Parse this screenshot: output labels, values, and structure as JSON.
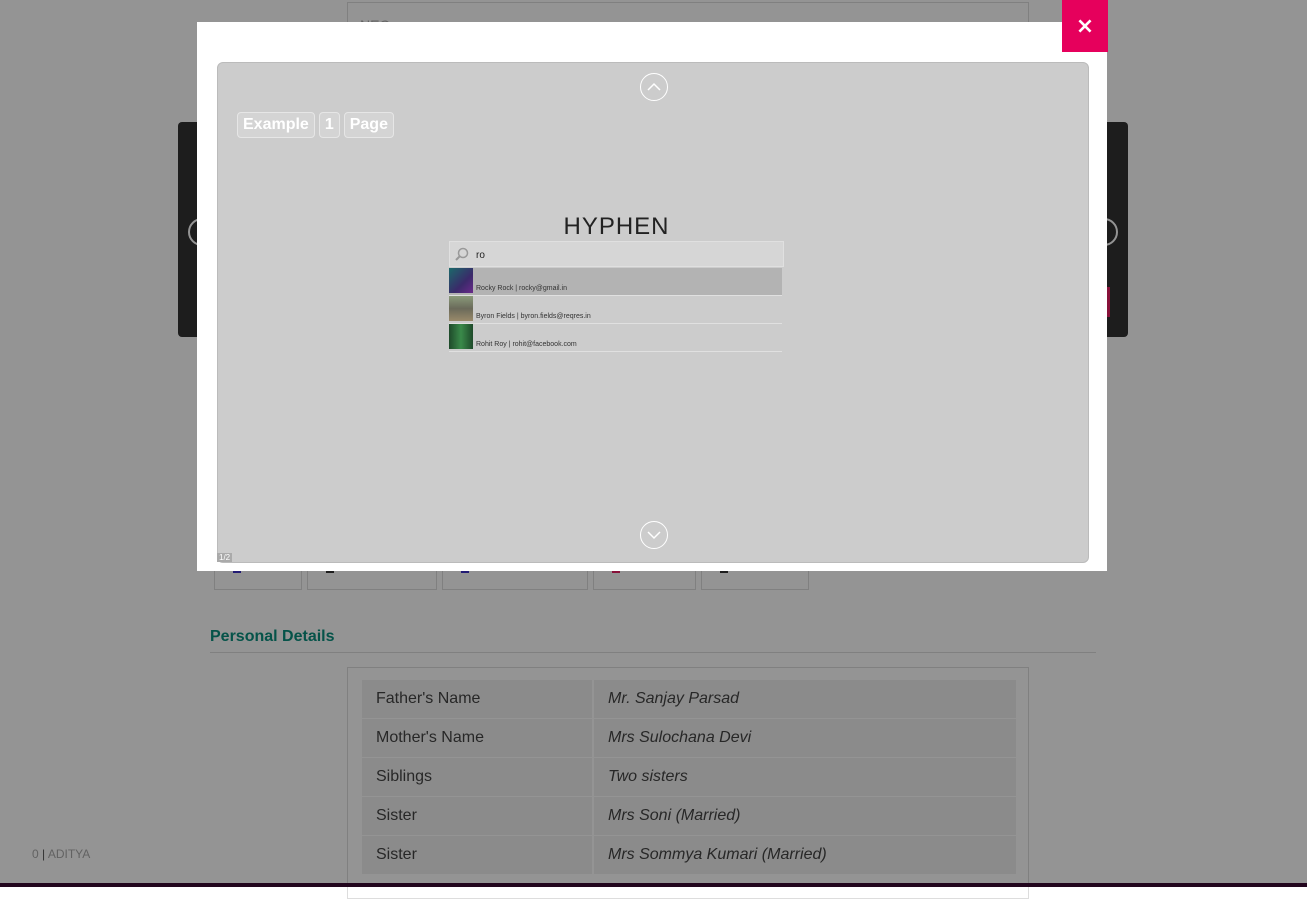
{
  "background": {
    "top_box_text": "NEO..........",
    "section_title": "Personal Details",
    "details": [
      {
        "key": "Father's Name",
        "value": "Mr. Sanjay Parsad"
      },
      {
        "key": "Mother's Name",
        "value": "Mrs Sulochana Devi"
      },
      {
        "key": "Siblings",
        "value": "Two sisters"
      },
      {
        "key": "Sister",
        "value": "Mrs Soni (Married)"
      },
      {
        "key": "Sister",
        "value": "Mrs Sommya Kumari (Married)"
      }
    ],
    "footer": {
      "count": "0",
      "separator": "|",
      "user": "ADITYA"
    }
  },
  "modal": {
    "close_label": "×",
    "breadcrumb": [
      "Example",
      "1",
      "Page"
    ],
    "demo_title": "HYPHEN",
    "search": {
      "value": "ro",
      "placeholder": ""
    },
    "results": [
      {
        "text": "Rocky Rock | rocky@gmail.in",
        "active": true,
        "thumb_color": "#3a2a6a"
      },
      {
        "text": "Byron Fields | byron.fields@reqres.in",
        "active": false,
        "thumb_color": "#7a8a6a"
      },
      {
        "text": "Rohit Roy | rohit@facebook.com",
        "active": false,
        "thumb_color": "#2e6a3a"
      }
    ],
    "page_indicator": "1/2"
  },
  "colors": {
    "accent": "#e6005c",
    "section_title": "#0a8f7e"
  }
}
